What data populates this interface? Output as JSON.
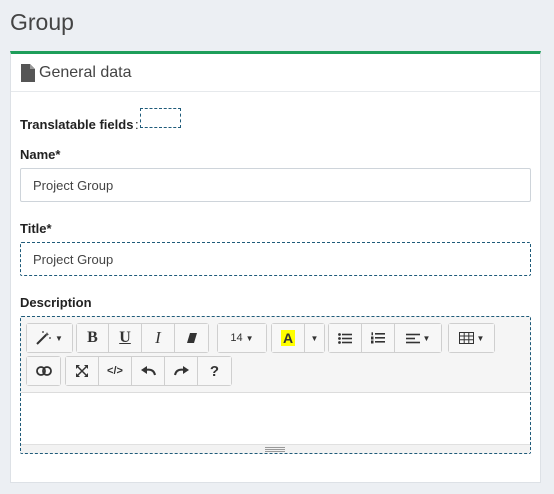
{
  "page": {
    "title": "Group"
  },
  "card": {
    "title": "General data",
    "icon": "file-icon",
    "accent_color": "#1e9e5a"
  },
  "form": {
    "translatable_label": "Translatable fields",
    "translatable_colon": ":",
    "name_label": "Name*",
    "name_value": "Project Group",
    "title_label": "Title*",
    "title_value": "Project Group",
    "description_label": "Description"
  },
  "editor": {
    "font_size": "14",
    "highlight_letter": "A",
    "highlight_color": "#ffff00",
    "bold": "B",
    "underline": "U",
    "italic": "I",
    "codeview": "</>",
    "help": "?"
  }
}
